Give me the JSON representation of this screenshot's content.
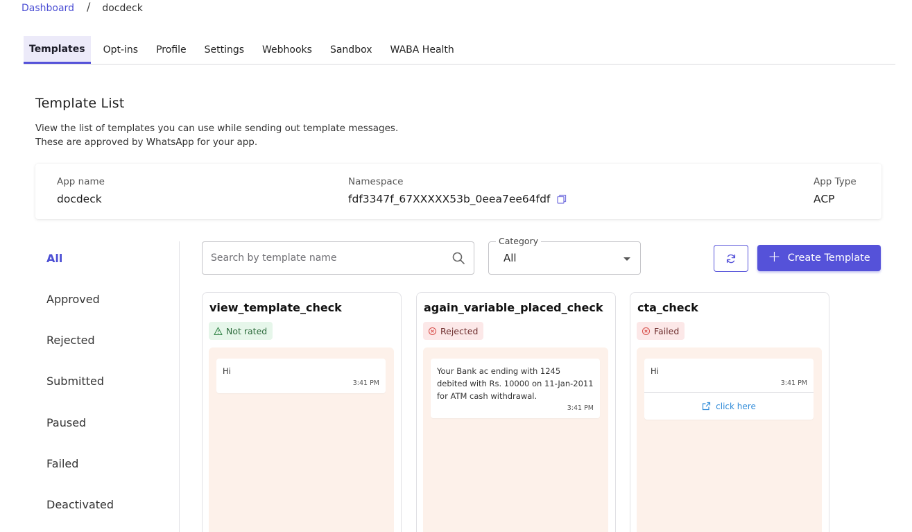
{
  "breadcrumb": {
    "parent": "Dashboard",
    "separator": "/",
    "current": "docdeck"
  },
  "tabs": [
    {
      "label": "Templates",
      "active": true
    },
    {
      "label": "Opt-ins"
    },
    {
      "label": "Profile"
    },
    {
      "label": "Settings"
    },
    {
      "label": "Webhooks"
    },
    {
      "label": "Sandbox"
    },
    {
      "label": "WABA Health"
    }
  ],
  "section": {
    "title": "Template List",
    "desc_line1": "View the list of templates you can use while sending out template messages.",
    "desc_line2": "These are approved by WhatsApp for your app."
  },
  "app_info": {
    "app_name_label": "App name",
    "app_name": "docdeck",
    "namespace_label": "Namespace",
    "namespace": "fdf3347f_67XXXXX53b_0eea7ee64fdf",
    "app_type_label": "App Type",
    "app_type": "ACP"
  },
  "filters": [
    {
      "label": "All",
      "active": true
    },
    {
      "label": "Approved"
    },
    {
      "label": "Rejected"
    },
    {
      "label": "Submitted"
    },
    {
      "label": "Paused"
    },
    {
      "label": "Failed"
    },
    {
      "label": "Deactivated"
    }
  ],
  "search": {
    "placeholder": "Search by template name"
  },
  "category": {
    "label": "Category",
    "value": "All"
  },
  "toolbar": {
    "create_label": "Create Template"
  },
  "templates": [
    {
      "name": "view_template_check",
      "status": "Not rated",
      "message": "Hi",
      "time": "3:41 PM"
    },
    {
      "name": "again_variable_placed_check",
      "status": "Rejected",
      "message": "Your Bank ac ending with 1245\ndebited with Rs. 10000 on 11-Jan-2011\nfor ATM cash withdrawal.",
      "time": "3:41 PM"
    },
    {
      "name": "cta_check",
      "status": "Failed",
      "message": "Hi",
      "time": "3:41 PM",
      "cta": "click here"
    }
  ],
  "colors": {
    "accent": "#5552d9",
    "preview_bg": "#fdf1ea",
    "link": "#2e8ad8"
  }
}
